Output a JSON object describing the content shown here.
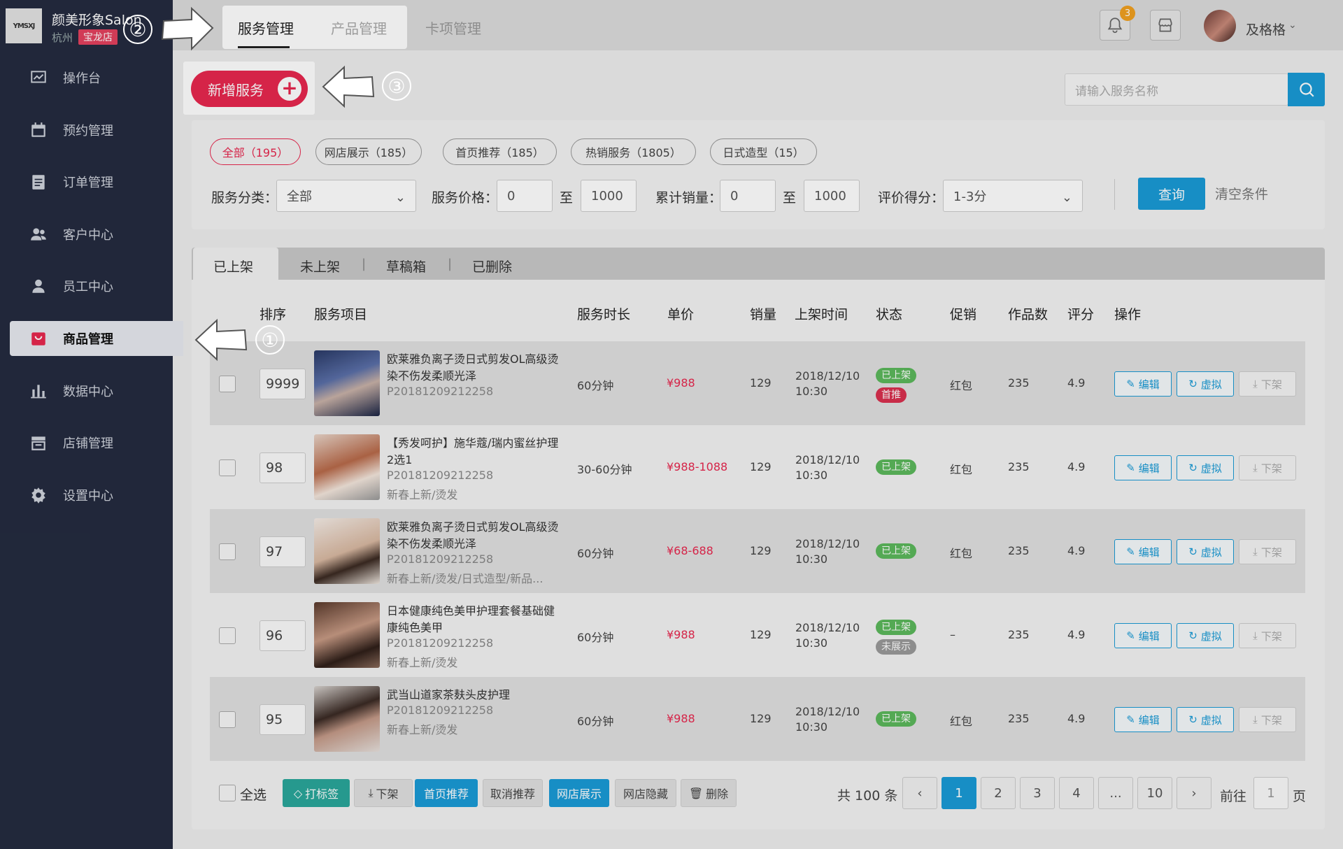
{
  "brand": {
    "logo_text": "YMSXJ",
    "shop_name": "颜美形象Salon",
    "city": "杭州",
    "branch": "宝龙店"
  },
  "top_tabs": [
    "服务管理",
    "产品管理",
    "卡项管理"
  ],
  "header": {
    "notification_count": "3",
    "user_name": "及格格"
  },
  "sidebar": {
    "items": [
      {
        "label": "操作台",
        "icon": "dashboard-icon"
      },
      {
        "label": "预约管理",
        "icon": "calendar-icon"
      },
      {
        "label": "订单管理",
        "icon": "clipboard-icon"
      },
      {
        "label": "客户中心",
        "icon": "customers-icon"
      },
      {
        "label": "员工中心",
        "icon": "staff-icon"
      },
      {
        "label": "商品管理",
        "icon": "goods-icon",
        "active": true
      },
      {
        "label": "数据中心",
        "icon": "bar-chart-icon"
      },
      {
        "label": "店铺管理",
        "icon": "store-icon"
      },
      {
        "label": "设置中心",
        "icon": "gear-icon"
      }
    ]
  },
  "toolbar": {
    "new_service": "新增服务",
    "search_placeholder": "请输入服务名称"
  },
  "filter_chips": [
    "全部（195）",
    "网店展示（185）",
    "首页推荐（185）",
    "热销服务（1805）",
    "日式造型（15）"
  ],
  "filters": {
    "category_label": "服务分类：",
    "category_value": "全部",
    "price_label": "服务价格：",
    "price_min": "0",
    "price_to": "至",
    "price_max": "1000",
    "sales_label": "累计销量：",
    "sales_min": "0",
    "sales_to": "至",
    "sales_max": "1000",
    "rating_label": "评价得分：",
    "rating_value": "1-3分",
    "query": "查询",
    "clear": "清空条件"
  },
  "sub_tabs": [
    "已上架",
    "未上架",
    "草稿箱",
    "已删除"
  ],
  "columns": [
    "排序",
    "服务项目",
    "服务时长",
    "单价",
    "销量",
    "上架时间",
    "状态",
    "促销",
    "作品数",
    "评分",
    "操作"
  ],
  "row_actions": {
    "edit": "编辑",
    "virtual": "虚拟",
    "unlist": "下架"
  },
  "rows": [
    {
      "sort": "9999",
      "name": "欧莱雅负离子烫日式剪发OL高级烫染不伤发柔顺光泽",
      "code": "P20181209212258",
      "tags": "",
      "duration": "60分钟",
      "price": "¥988",
      "sales": "129",
      "date": "2018/12/10",
      "time": "10:30",
      "status": [
        "已上架",
        "首推"
      ],
      "promo": "红包",
      "works": "235",
      "rating": "4.9"
    },
    {
      "sort": "98",
      "name": "【秀发呵护】施华蔻/瑞内蜜丝护理2选1",
      "code": "P20181209212258",
      "tags": "新春上新/烫发",
      "duration": "30-60分钟",
      "price": "¥988-1088",
      "sales": "129",
      "date": "2018/12/10",
      "time": "10:30",
      "status": [
        "已上架"
      ],
      "promo": "红包",
      "works": "235",
      "rating": "4.9"
    },
    {
      "sort": "97",
      "name": "欧莱雅负离子烫日式剪发OL高级烫染不伤发柔顺光泽",
      "code": "P20181209212258",
      "tags": "新春上新/烫发/日式造型/新品...",
      "duration": "60分钟",
      "price": "¥68-688",
      "sales": "129",
      "date": "2018/12/10",
      "time": "10:30",
      "status": [
        "已上架"
      ],
      "promo": "红包",
      "works": "235",
      "rating": "4.9"
    },
    {
      "sort": "96",
      "name": "日本健康纯色美甲护理套餐基础健康纯色美甲",
      "code": "P20181209212258",
      "tags": "新春上新/烫发",
      "duration": "60分钟",
      "price": "¥988",
      "sales": "129",
      "date": "2018/12/10",
      "time": "10:30",
      "status": [
        "已上架",
        "未展示"
      ],
      "promo": "–",
      "works": "235",
      "rating": "4.9"
    },
    {
      "sort": "95",
      "name": "武当山道家茶麸头皮护理",
      "code": "P20181209212258",
      "tags": "新春上新/烫发",
      "duration": "60分钟",
      "price": "¥988",
      "sales": "129",
      "date": "2018/12/10",
      "time": "10:30",
      "status": [
        "已上架"
      ],
      "promo": "红包",
      "works": "235",
      "rating": "4.9"
    }
  ],
  "bulk": {
    "select_all": "全选",
    "tag": "打标签",
    "unlist": "下架",
    "recommend": "首页推荐",
    "cancel_recommend": "取消推荐",
    "show_online": "网店展示",
    "hide_online": "网店隐藏",
    "delete": "删除"
  },
  "pagination": {
    "total": "共 100 条",
    "prev": "‹",
    "next": "›",
    "pages": [
      "1",
      "2",
      "3",
      "4",
      "...",
      "10"
    ],
    "current": "1",
    "goto_label": "前往",
    "goto_value": "1",
    "page_suffix": "页"
  },
  "annotations": [
    "①",
    "②",
    "③"
  ]
}
